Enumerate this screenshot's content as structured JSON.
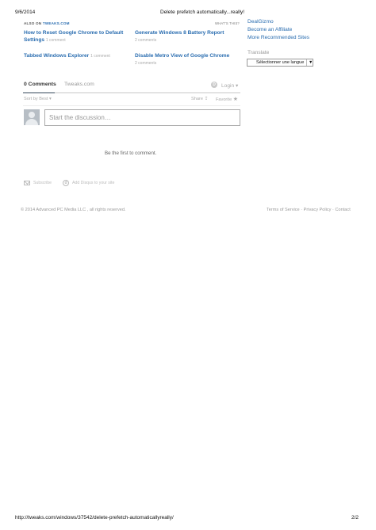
{
  "print_header": {
    "date": "9/6/2014",
    "title": "Delete prefetch automatically...really!"
  },
  "also_on": {
    "prefix": "ALSO ON ",
    "site": "TWEAKS.COM",
    "whats_this": "WHAT'S THIS?",
    "items": [
      {
        "title": "How to Reset Google Chrome to Default Settings",
        "count": "1 comment"
      },
      {
        "title": "Generate Windows 8 Battery Report",
        "count": "2 comments"
      },
      {
        "title": "Tabbed Windows Explorer",
        "count": "1 comment"
      },
      {
        "title": "Disable Metro View of Google Chrome",
        "count": "2 comments"
      }
    ]
  },
  "sidebar": {
    "links": [
      "DealGizmo",
      "Become an Affiliate",
      "More Recommended Sites"
    ],
    "translate_label": "Translate",
    "language_select": "Sélectionner une langue",
    "select_arrow": "▼"
  },
  "disqus": {
    "tab_comments": "0 Comments",
    "tab_site": "Tweaks.com",
    "login": "Login",
    "login_icon_letter": "D",
    "login_arrow": "▾",
    "sort": "Sort by Best ▾",
    "share": "Share",
    "share_icon": "⇪",
    "favorite": "Favorite",
    "star_icon": "★",
    "input_placeholder": "Start the discussion…",
    "empty_message": "Be the first to comment.",
    "subscribe": "Subscribe",
    "add_disqus": "Add Disqus to your site",
    "disqus_icon_letter": "d"
  },
  "footer": {
    "copyright": "© 2014 Advanced PC Media LLC , all rights reserved.",
    "terms": "Terms of Service",
    "privacy": "Privacy Policy",
    "contact": "Contact",
    "separator": "·"
  },
  "print_footer": {
    "url": "http://tweaks.com/windows/37542/delete-prefetch-automaticallyreally/",
    "page": "2/2"
  }
}
